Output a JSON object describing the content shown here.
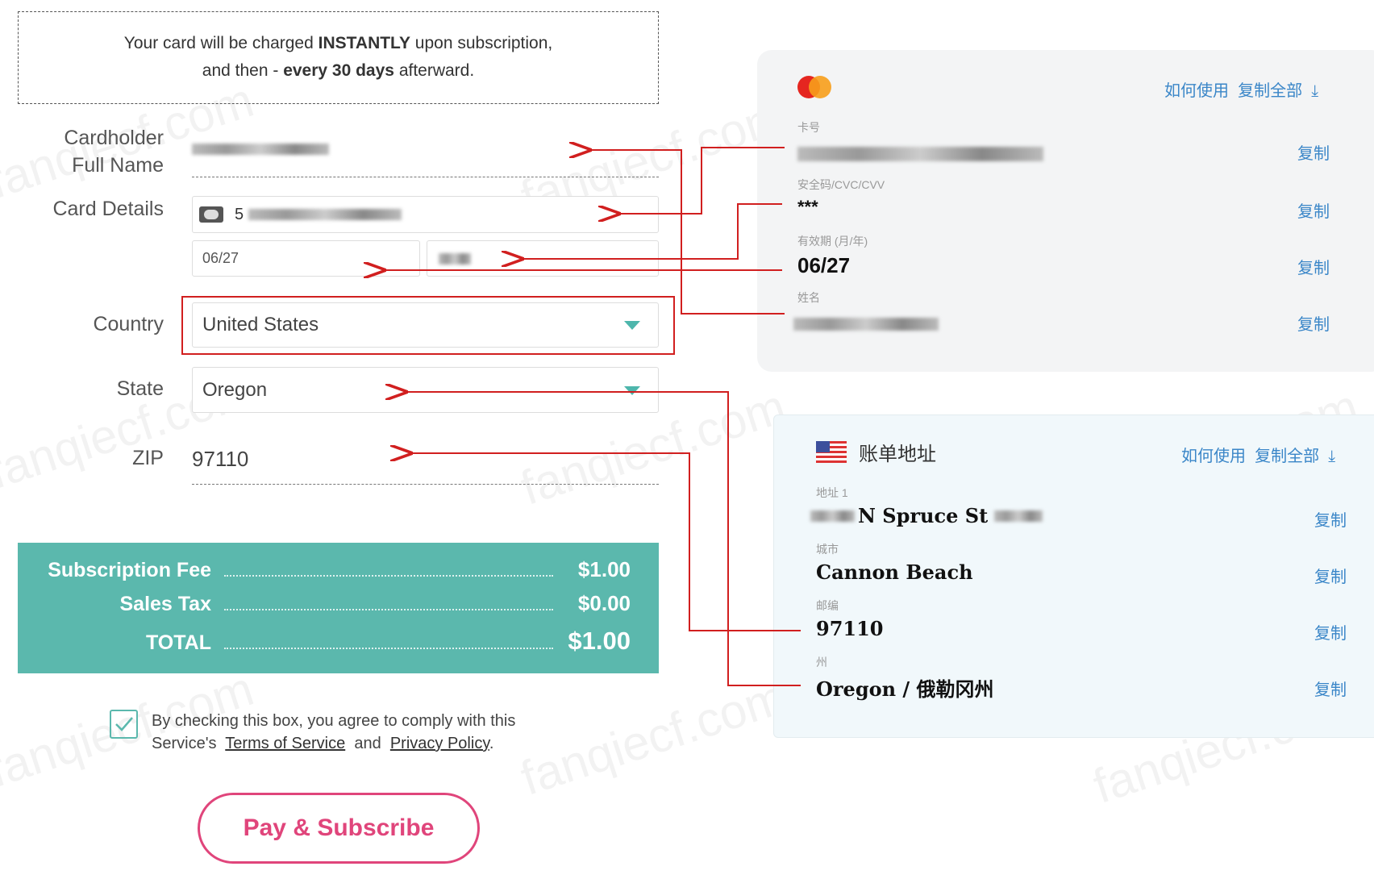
{
  "notice": {
    "line1_a": "Your card will be charged ",
    "line1_b": "INSTANTLY",
    "line1_c": " upon subscription,",
    "line2_a": "and then - ",
    "line2_b": "every 30 days",
    "line2_c": " afterward."
  },
  "form": {
    "cardholder_label_1": "Cardholder",
    "cardholder_label_2": "Full Name",
    "card_details_label": "Card Details",
    "card_number_prefix": "5",
    "expiry": "06/27",
    "country_label": "Country",
    "country_value": "United States",
    "state_label": "State",
    "state_value": "Oregon",
    "zip_label": "ZIP",
    "zip_value": "97110"
  },
  "fees": [
    {
      "label": "Subscription Fee",
      "value": "$1.00"
    },
    {
      "label": "Sales Tax",
      "value": "$0.00"
    },
    {
      "label": "TOTAL",
      "value": "$1.00"
    }
  ],
  "agreement": {
    "checked": true,
    "text1": "By checking this box, you agree to comply with this",
    "text2": "Service's",
    "terms": "Terms of Service",
    "and": "and",
    "privacy": "Privacy Policy",
    "period": "."
  },
  "pay_button": "Pay & Subscribe",
  "card_panel": {
    "how_to": "如何使用",
    "copy_all": "复制全部",
    "copy": "复制",
    "number_label": "卡号",
    "cvv_label": "安全码/CVC/CVV",
    "cvv_value": "***",
    "expiry_label": "有效期 (月/年)",
    "expiry_value": "06/27",
    "name_label": "姓名"
  },
  "address_panel": {
    "title": "账单地址",
    "how_to": "如何使用",
    "copy_all": "复制全部",
    "copy": "复制",
    "address_label": "地址 1",
    "address_value": "N Spruce St",
    "city_label": "城市",
    "city_value": "Cannon Beach",
    "zip_label": "邮编",
    "zip_value": "97110",
    "state_label": "州",
    "state_value": "Oregon / 俄勒冈州"
  },
  "watermark": "fanqiecf.com",
  "colors": {
    "accent": "#5bb8ad",
    "arrow": "#d11f1f",
    "button": "#e0457b",
    "link": "#3a86c8"
  }
}
